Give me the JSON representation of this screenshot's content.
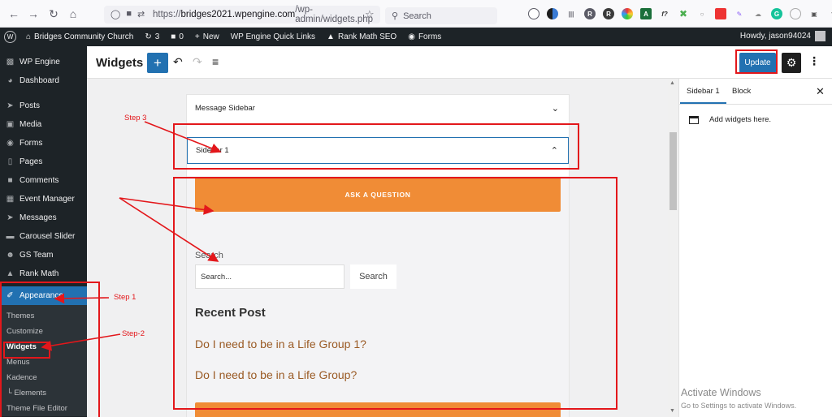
{
  "browser": {
    "url_host": "bridges2021.wpengine.com",
    "url_prefix": "https://",
    "url_path": "/wp-admin/widgets.php",
    "search_placeholder": "Search"
  },
  "admin_bar": {
    "site_name": "Bridges Community Church",
    "updates_count": "3",
    "comments_count": "0",
    "new_label": "New",
    "quick_links": "WP Engine Quick Links",
    "rank_math": "Rank Math SEO",
    "forms": "Forms",
    "howdy": "Howdy, jason94024"
  },
  "sidebar": {
    "items": [
      {
        "label": "WP Engine",
        "icon": "wpengine-icon"
      },
      {
        "label": "Dashboard",
        "icon": "dashboard-icon"
      },
      {
        "label": "Posts",
        "icon": "pin-icon"
      },
      {
        "label": "Media",
        "icon": "media-icon"
      },
      {
        "label": "Forms",
        "icon": "forms-icon"
      },
      {
        "label": "Pages",
        "icon": "pages-icon"
      },
      {
        "label": "Comments",
        "icon": "comment-icon"
      },
      {
        "label": "Event Manager",
        "icon": "calendar-icon"
      },
      {
        "label": "Messages",
        "icon": "pin-icon"
      },
      {
        "label": "Carousel Slider",
        "icon": "slider-icon"
      },
      {
        "label": "GS Team",
        "icon": "team-icon"
      },
      {
        "label": "Rank Math",
        "icon": "rankmath-icon"
      },
      {
        "label": "Appearance",
        "icon": "brush-icon"
      }
    ],
    "submenu": [
      "Themes",
      "Customize",
      "Widgets",
      "Menus",
      "Kadence",
      "└ Elements",
      "Theme File Editor"
    ]
  },
  "header": {
    "title": "Widgets",
    "update_label": "Update"
  },
  "canvas": {
    "message_sidebar": "Message Sidebar",
    "sidebar_1": "Sidebar 1",
    "ask_button": "ASK A QUESTION",
    "search_label": "Search",
    "search_placeholder": "Search...",
    "search_button": "Search",
    "recent_title": "Recent Post",
    "posts": [
      "Do I need to be in a Life Group 1?",
      "Do I need to be in a Life Group?"
    ]
  },
  "inspector": {
    "tab_sidebar": "Sidebar 1",
    "tab_block": "Block",
    "message": "Add widgets here."
  },
  "watermark": {
    "title": "Activate Windows",
    "subtitle": "Go to Settings to activate Windows."
  },
  "annotations": {
    "step1": "Step 1",
    "step2": "Step-2",
    "step3": "Step 3"
  },
  "colors": {
    "accent": "#2271b1",
    "orange": "#f08c36",
    "annotation": "#e3171b"
  }
}
